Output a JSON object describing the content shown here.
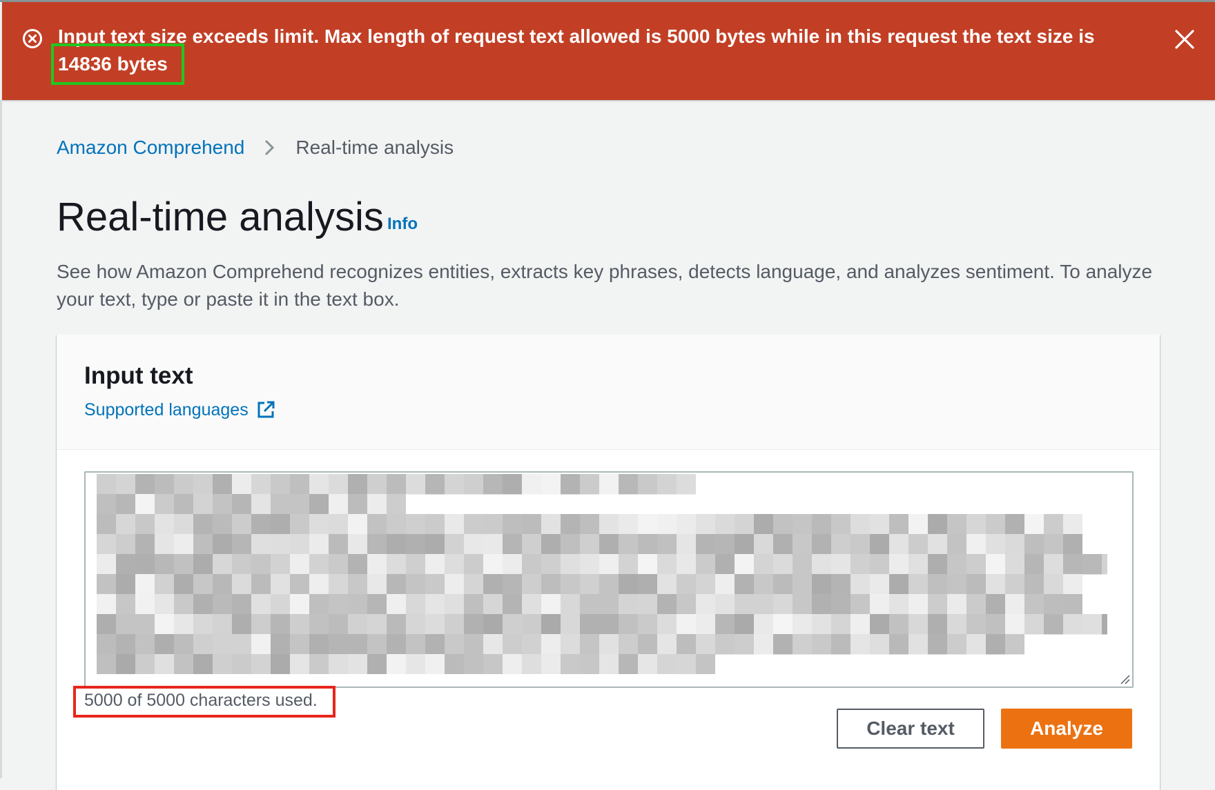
{
  "alert": {
    "message": "Input text size exceeds limit. Max length of request text allowed is 5000 bytes while in this request the text size is",
    "highlight": "14836 bytes",
    "icon": "error-circle-x-icon",
    "close_icon": "close-icon",
    "color": "#c23f25"
  },
  "breadcrumb": {
    "items": [
      {
        "label": "Amazon Comprehend"
      },
      {
        "label": "Real-time analysis"
      }
    ],
    "separator_icon": "chevron-right-icon"
  },
  "header": {
    "title": "Real-time analysis",
    "info_label": "Info",
    "description": "See how Amazon Comprehend recognizes entities, extracts key phrases, detects language, and analyzes sentiment. To analyze your text, type or paste it in the text box."
  },
  "input_panel": {
    "title": "Input text",
    "languages_link": "Supported languages",
    "languages_link_icon": "external-link-icon",
    "counter": "5000 of 5000 characters used.",
    "clear_label": "Clear text",
    "analyze_label": "Analyze"
  },
  "colors": {
    "link": "#0073bb",
    "primary_button": "#ec7211",
    "highlight_green": "#20c71f",
    "highlight_red": "#e8261c"
  }
}
